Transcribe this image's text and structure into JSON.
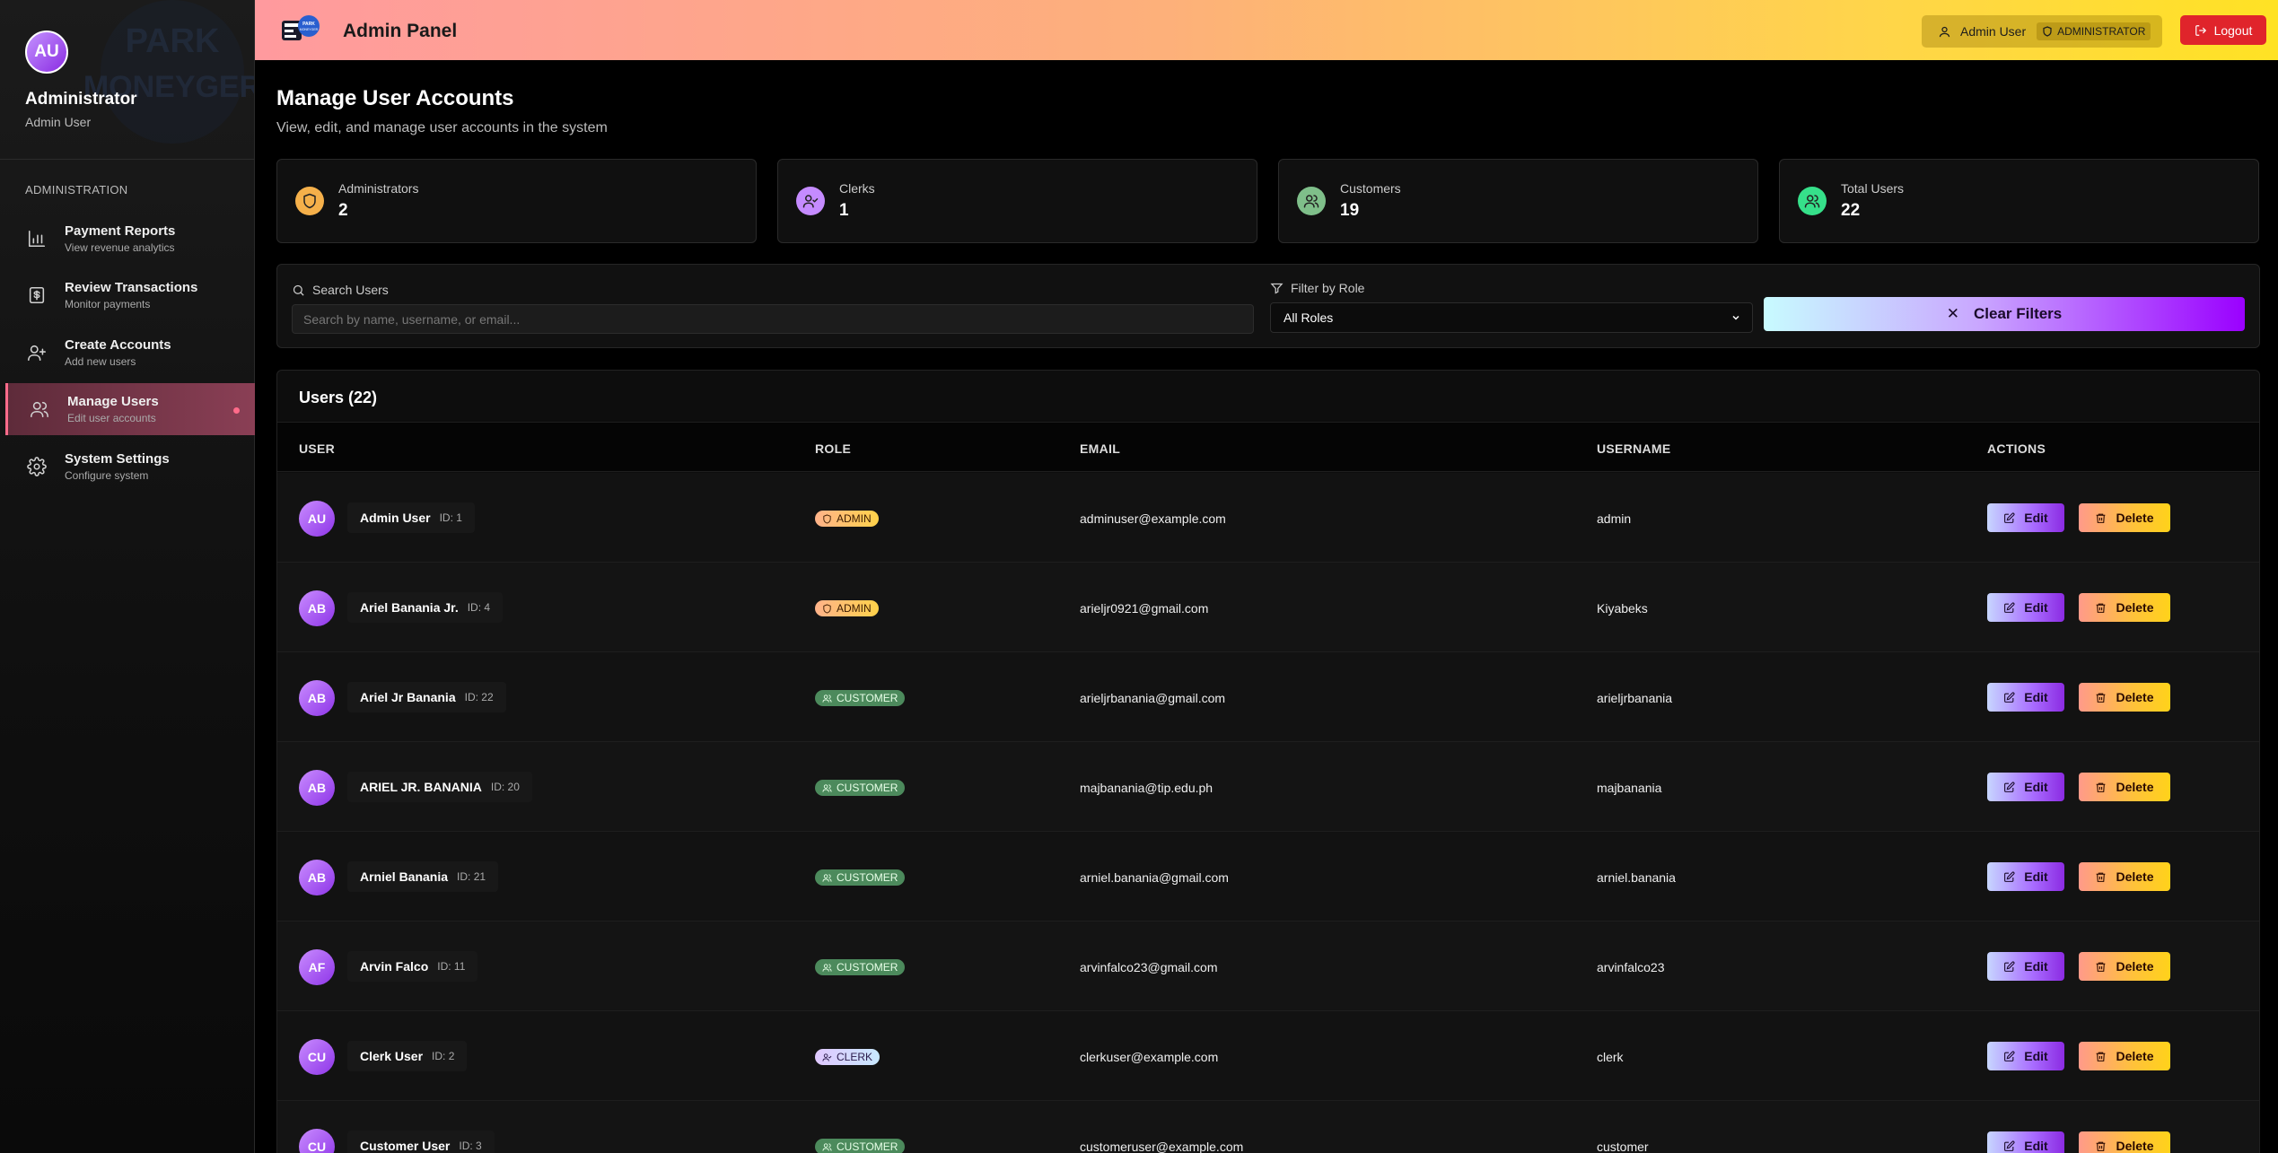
{
  "sidebar": {
    "avatar_initials": "AU",
    "role_title": "Administrator",
    "user_name": "Admin User",
    "section_label": "ADMINISTRATION",
    "items": [
      {
        "label": "Payment Reports",
        "sub": "View revenue analytics",
        "icon": "bar-chart-icon",
        "active": false
      },
      {
        "label": "Review Transactions",
        "sub": "Monitor payments",
        "icon": "dollar-receipt-icon",
        "active": false
      },
      {
        "label": "Create Accounts",
        "sub": "Add new users",
        "icon": "user-plus-icon",
        "active": false
      },
      {
        "label": "Manage Users",
        "sub": "Edit user accounts",
        "icon": "users-icon",
        "active": true
      },
      {
        "label": "System Settings",
        "sub": "Configure system",
        "icon": "gear-icon",
        "active": false
      }
    ],
    "watermark_text": [
      "PARK",
      "MONEYGER"
    ]
  },
  "header": {
    "title": "Admin Panel",
    "user_label": "Admin User",
    "role_badge": "ADMINISTRATOR",
    "logout_label": "Logout",
    "logo_text": "PARK MONEYGER"
  },
  "page": {
    "title": "Manage User Accounts",
    "subtitle": "View, edit, and manage user accounts in the system"
  },
  "stats": [
    {
      "label": "Administrators",
      "value": "2",
      "icon": "shield-icon",
      "color": "#f5b04a"
    },
    {
      "label": "Clerks",
      "value": "1",
      "icon": "user-check-icon",
      "color": "#c58bff"
    },
    {
      "label": "Customers",
      "value": "19",
      "icon": "users-icon",
      "color": "#7fbf8a"
    },
    {
      "label": "Total Users",
      "value": "22",
      "icon": "users-icon",
      "color": "#36e08a"
    }
  ],
  "filters": {
    "search_label": "Search Users",
    "search_placeholder": "Search by name, username, or email...",
    "search_value": "",
    "role_label": "Filter by Role",
    "role_selected": "All Roles",
    "clear_label": "Clear Filters"
  },
  "users_table": {
    "title": "Users (22)",
    "columns": [
      "USER",
      "ROLE",
      "EMAIL",
      "USERNAME",
      "ACTIONS"
    ],
    "edit_label": "Edit",
    "delete_label": "Delete",
    "rows": [
      {
        "initials": "AU",
        "name": "Admin User",
        "id": "ID: 1",
        "role": "ADMIN",
        "role_type": "admin",
        "email": "adminuser@example.com",
        "username": "admin"
      },
      {
        "initials": "AB",
        "name": "Ariel Banania Jr.",
        "id": "ID: 4",
        "role": "ADMIN",
        "role_type": "admin",
        "email": "arieljr0921@gmail.com",
        "username": "Kiyabeks"
      },
      {
        "initials": "AB",
        "name": "Ariel Jr Banania",
        "id": "ID: 22",
        "role": "CUSTOMER",
        "role_type": "customer",
        "email": "arieljrbanania@gmail.com",
        "username": "arieljrbanania"
      },
      {
        "initials": "AB",
        "name": "ARIEL JR. BANANIA",
        "id": "ID: 20",
        "role": "CUSTOMER",
        "role_type": "customer",
        "email": "majbanania@tip.edu.ph",
        "username": "majbanania"
      },
      {
        "initials": "AB",
        "name": "Arniel Banania",
        "id": "ID: 21",
        "role": "CUSTOMER",
        "role_type": "customer",
        "email": "arniel.banania@gmail.com",
        "username": "arniel.banania"
      },
      {
        "initials": "AF",
        "name": "Arvin Falco",
        "id": "ID: 11",
        "role": "CUSTOMER",
        "role_type": "customer",
        "email": "arvinfalco23@gmail.com",
        "username": "arvinfalco23"
      },
      {
        "initials": "CU",
        "name": "Clerk User",
        "id": "ID: 2",
        "role": "CLERK",
        "role_type": "clerk",
        "email": "clerkuser@example.com",
        "username": "clerk"
      },
      {
        "initials": "CU",
        "name": "Customer User",
        "id": "ID: 3",
        "role": "CUSTOMER",
        "role_type": "customer",
        "email": "customeruser@example.com",
        "username": "customer"
      }
    ]
  }
}
